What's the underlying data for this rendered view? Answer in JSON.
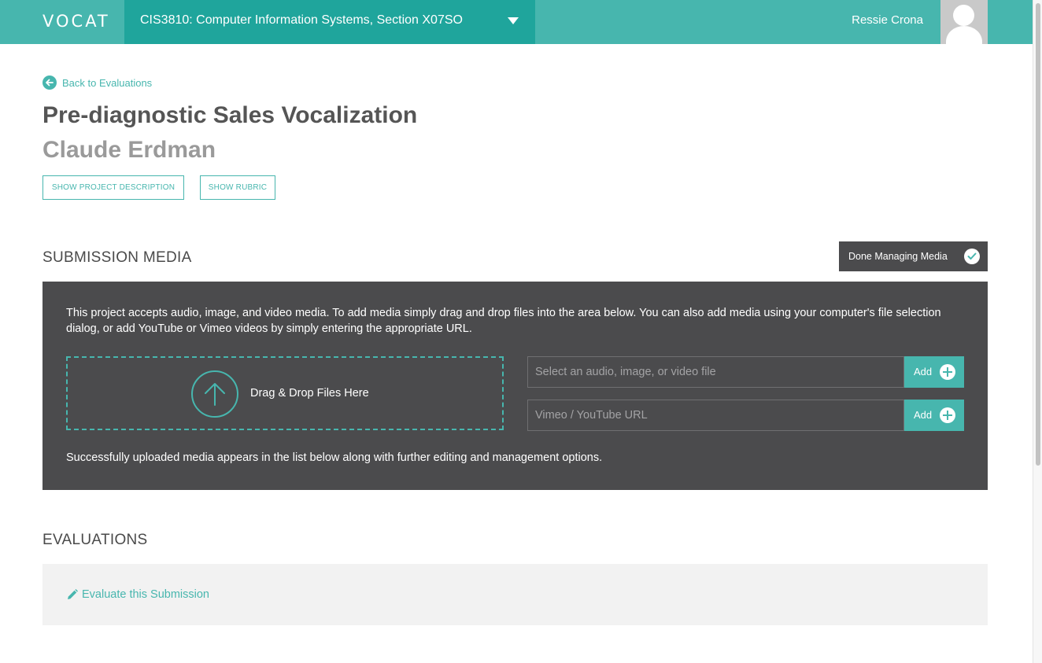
{
  "header": {
    "logo_text": "VOCAT",
    "course_label": "CIS3810: Computer Information Systems, Section X07SO",
    "user_name": "Ressie Crona"
  },
  "nav": {
    "back_label": "Back to Evaluations"
  },
  "page": {
    "title": "Pre-diagnostic Sales Vocalization",
    "subtitle": "Claude Erdman",
    "show_description_label": "SHOW PROJECT DESCRIPTION",
    "show_rubric_label": "SHOW RUBRIC"
  },
  "media": {
    "section_title": "SUBMISSION MEDIA",
    "done_label": "Done Managing Media",
    "info_text": "This project accepts audio, image, and video media. To add media simply drag and drop files into the area below. You can also add media using your computer's file selection dialog, or add YouTube or Vimeo videos by simply entering the appropriate URL.",
    "drop_label": "Drag & Drop Files Here",
    "file_placeholder": "Select an audio, image, or video file",
    "url_placeholder": "Vimeo / YouTube URL",
    "add_label": "Add",
    "footer_text": "Successfully uploaded media appears in the list below along with further editing and management options."
  },
  "evaluations": {
    "section_title": "EVALUATIONS",
    "evaluate_label": "Evaluate this Submission"
  },
  "colors": {
    "accent": "#47b6ae",
    "accent_dark": "#1fa59c",
    "panel_dark": "#4b4b4d",
    "panel_light": "#f2f2f2"
  },
  "icons": [
    "back-arrow-icon",
    "chevron-down-icon",
    "user-avatar-icon",
    "check-icon",
    "upload-arrow-icon",
    "plus-icon",
    "pencil-icon"
  ]
}
